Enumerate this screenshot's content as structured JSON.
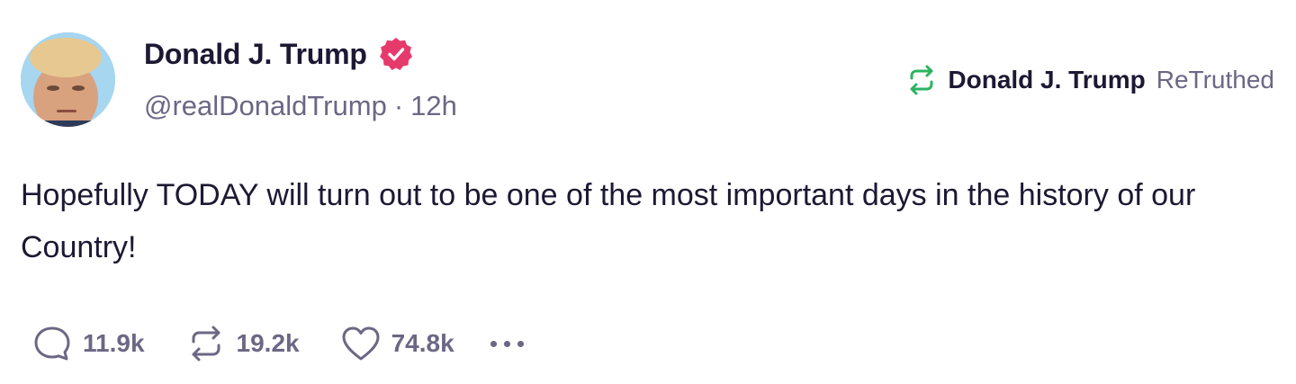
{
  "post": {
    "author": {
      "display_name": "Donald J. Trump",
      "handle": "@realDonaldTrump",
      "verified": true,
      "verified_icon": "verified-badge-icon",
      "verified_color": "#e63a6d"
    },
    "separator": "·",
    "time_ago": "12h",
    "retruth": {
      "icon": "retruth-icon",
      "icon_color": "#2db360",
      "name": "Donald J. Trump",
      "label": "ReTruthed"
    },
    "text": "Hopefully TODAY will turn out to be one of the most important days in the history of our Country!",
    "actions": {
      "replies": {
        "icon": "reply-icon",
        "count": "11.9k"
      },
      "retruths": {
        "icon": "retruth-icon",
        "count": "19.2k"
      },
      "likes": {
        "icon": "heart-icon",
        "count": "74.8k"
      },
      "more": {
        "icon": "more-options-icon"
      }
    }
  }
}
